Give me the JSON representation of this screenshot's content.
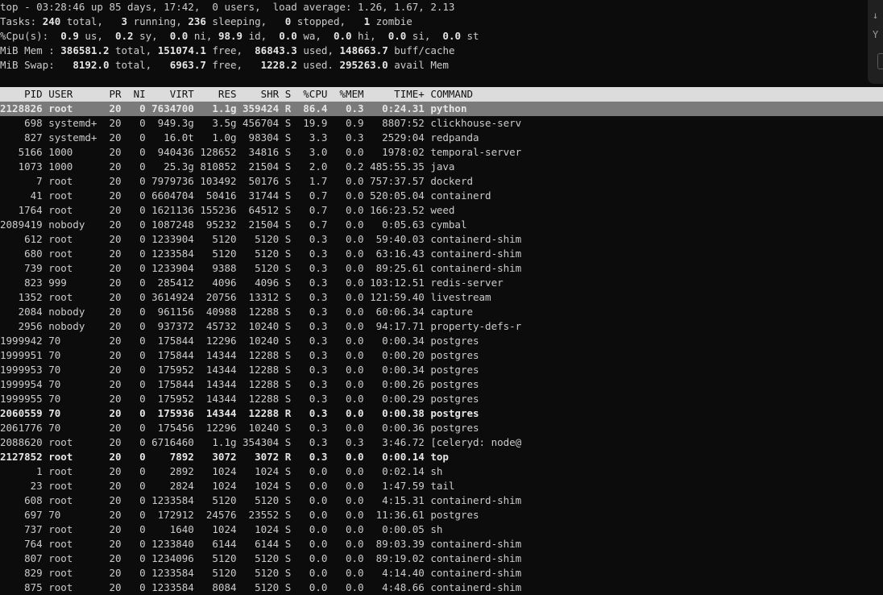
{
  "summary": {
    "l1": {
      "a": "top - 03:28:46 up 85 days, 17:42,  0 users,  load average: 1.26, 1.67, 2.13"
    },
    "l2": {
      "p1": "Tasks: ",
      "n1": "240",
      "p2": " total,   ",
      "n2": "3",
      "p3": " running, ",
      "n3": "236",
      "p4": " sleeping,   ",
      "n4": "0",
      "p5": " stopped,   ",
      "n5": "1",
      "p6": " zombie"
    },
    "l3": {
      "p1": "%Cpu(s):  ",
      "n1": "0.9",
      "p2": " us,  ",
      "n2": "0.2",
      "p3": " sy,  ",
      "n3": "0.0",
      "p4": " ni, ",
      "n4": "98.9",
      "p5": " id,  ",
      "n5": "0.0",
      "p6": " wa,  ",
      "n6": "0.0",
      "p7": " hi,  ",
      "n7": "0.0",
      "p8": " si,  ",
      "n8": "0.0",
      "p9": " st"
    },
    "l4": {
      "p1": "MiB Mem : ",
      "n1": "386581.2",
      "p2": " total, ",
      "n2": "151074.1",
      "p3": " free,  ",
      "n3": "86843.3",
      "p4": " used, ",
      "n4": "148663.7",
      "p5": " buff/cache"
    },
    "l5": {
      "p1": "MiB Swap:   ",
      "n1": "8192.0",
      "p2": " total,   ",
      "n2": "6963.7",
      "p3": " free,   ",
      "n3": "1228.2",
      "p4": " used. ",
      "n4": "295263.0",
      "p5": " avail Mem"
    }
  },
  "column_header": "    PID USER      PR  NI    VIRT    RES    SHR S  %CPU  %MEM     TIME+ COMMAND",
  "processes": [
    "2128826 root      20   0 7634700   1.1g 359424 R  86.4   0.3   0:24.31 python",
    "    698 systemd+  20   0  949.3g   3.5g 456704 S  19.9   0.9   8807:52 clickhouse-serv",
    "    827 systemd+  20   0   16.0t   1.0g  98304 S   3.3   0.3   2529:04 redpanda",
    "   5166 1000      20   0  940436 128652  34816 S   3.0   0.0   1978:02 temporal-server",
    "   1073 1000      20   0   25.3g 810852  21504 S   2.0   0.2 485:55.35 java",
    "      7 root      20   0 7979736 103492  50176 S   1.7   0.0 757:37.57 dockerd",
    "     41 root      20   0 6604704  50416  31744 S   0.7   0.0 520:05.04 containerd",
    "   1764 root      20   0 1621136 155236  64512 S   0.7   0.0 166:23.52 weed",
    "2089419 nobody    20   0 1087248  95232  21504 S   0.7   0.0   0:05.63 cymbal",
    "    612 root      20   0 1233904   5120   5120 S   0.3   0.0  59:40.03 containerd-shim",
    "    680 root      20   0 1233584   5120   5120 S   0.3   0.0  63:16.43 containerd-shim",
    "    739 root      20   0 1233904   9388   5120 S   0.3   0.0  89:25.61 containerd-shim",
    "    823 999       20   0  285412   4096   4096 S   0.3   0.0 103:12.51 redis-server",
    "   1352 root      20   0 3614924  20756  13312 S   0.3   0.0 121:59.40 livestream",
    "   2084 nobody    20   0  961156  40988  12288 S   0.3   0.0  60:06.34 capture",
    "   2956 nobody    20   0  937372  45732  10240 S   0.3   0.0  94:17.71 property-defs-r",
    "1999942 70        20   0  175844  12296  10240 S   0.3   0.0   0:00.34 postgres",
    "1999951 70        20   0  175844  14344  12288 S   0.3   0.0   0:00.20 postgres",
    "1999953 70        20   0  175952  14344  12288 S   0.3   0.0   0:00.34 postgres",
    "1999954 70        20   0  175844  14344  12288 S   0.3   0.0   0:00.26 postgres",
    "1999955 70        20   0  175952  14344  12288 S   0.3   0.0   0:00.29 postgres",
    "2060559 70        20   0  175936  14344  12288 R   0.3   0.0   0:00.38 postgres",
    "2061776 70        20   0  175456  12296  10240 S   0.3   0.0   0:00.36 postgres",
    "2088620 root      20   0 6716460   1.1g 354304 S   0.3   0.3   3:46.72 [celeryd: node@",
    "2127852 root      20   0    7892   3072   3072 R   0.3   0.0   0:00.14 top",
    "      1 root      20   0    2892   1024   1024 S   0.0   0.0   0:02.14 sh",
    "     23 root      20   0    2824   1024   1024 S   0.0   0.0   1:47.59 tail",
    "    608 root      20   0 1233584   5120   5120 S   0.0   0.0   4:15.31 containerd-shim",
    "    697 70        20   0  172912  24576  23552 S   0.0   0.0  11:36.61 postgres",
    "    737 root      20   0    1640   1024   1024 S   0.0   0.0   0:00.05 sh",
    "    764 root      20   0 1233840   6144   6144 S   0.0   0.0  89:03.39 containerd-shim",
    "    807 root      20   0 1234096   5120   5120 S   0.0   0.0  89:19.02 containerd-shim",
    "    829 root      20   0 1233584   5120   5120 S   0.0   0.0   4:14.40 containerd-shim",
    "    875 root      20   0 1233584   8084   5120 S   0.0   0.0   4:48.66 containerd-shim"
  ],
  "side_panel": {
    "glyph1": "↓",
    "glyph2": "Y"
  }
}
